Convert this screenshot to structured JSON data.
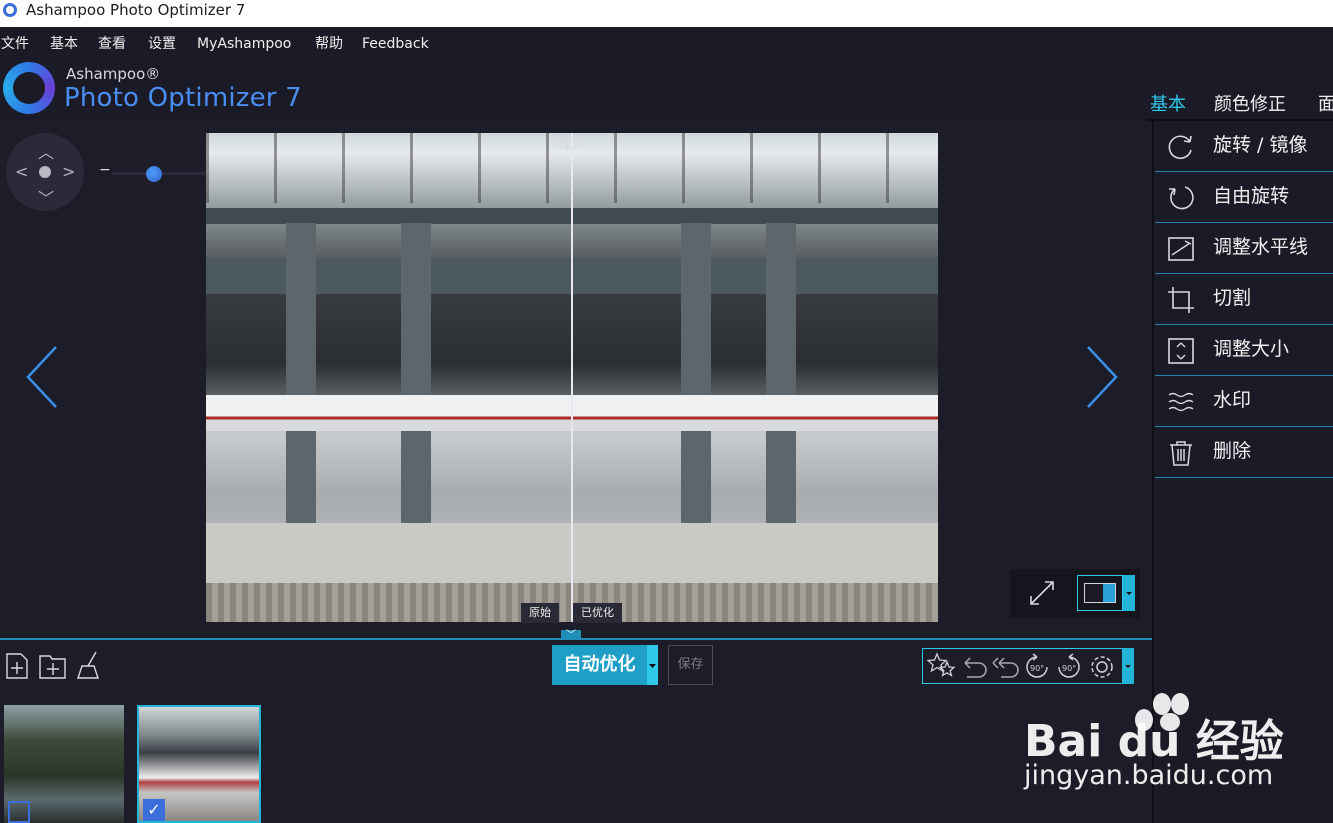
{
  "window": {
    "title": "Ashampoo Photo Optimizer 7"
  },
  "menu": [
    "文件",
    "基本",
    "查看",
    "设置",
    "MyAshampoo",
    "帮助",
    "Feedback"
  ],
  "brand": {
    "small": "Ashampoo®",
    "big": "Photo Optimizer 7"
  },
  "tabs": [
    {
      "label": "基本",
      "active": true
    },
    {
      "label": "颜色修正",
      "active": false
    },
    {
      "label": "面",
      "active": false
    }
  ],
  "panel_items": [
    {
      "label": "旋转 / 镜像",
      "icon": "rotate-mirror-icon"
    },
    {
      "label": "自由旋转",
      "icon": "free-rotate-icon"
    },
    {
      "label": "调整水平线",
      "icon": "horizon-icon"
    },
    {
      "label": "切割",
      "icon": "crop-icon"
    },
    {
      "label": "调整大小",
      "icon": "resize-icon"
    },
    {
      "label": "水印",
      "icon": "watermark-icon"
    },
    {
      "label": "删除",
      "icon": "trash-icon"
    }
  ],
  "viewer": {
    "zoom_minus": "−",
    "zoom_plus": "+",
    "zoom_level": 0.3,
    "compare_left": "原始",
    "compare_right": "已优化"
  },
  "toolbar": {
    "auto_optimize": "自动优化",
    "save": "保存"
  },
  "thumbnails": [
    {
      "selected": false
    },
    {
      "selected": true
    }
  ],
  "watermark": {
    "logo_text": "Bai du 经验",
    "url": "jingyan.baidu.com"
  },
  "colors": {
    "accent": "#2ec8ea",
    "auto_btn": "#1f9fc8",
    "bg": "#1b1b27",
    "brand_blue": "#4a8df0"
  }
}
